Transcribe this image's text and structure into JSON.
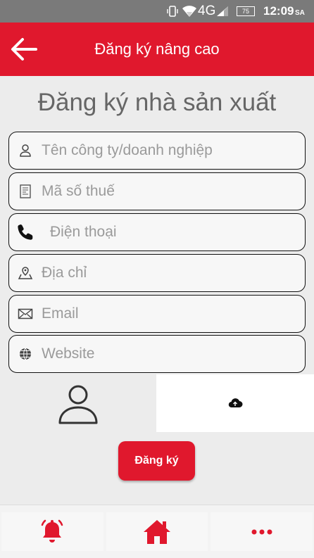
{
  "status_bar": {
    "network": "4G",
    "battery": "75",
    "time": "12:09",
    "ampm": "SA",
    "icons": [
      "vibrate-icon",
      "wifi-icon",
      "signal-icon",
      "battery-icon"
    ]
  },
  "app_bar": {
    "title": "Đăng ký nâng cao",
    "back_icon": "arrow-left-icon"
  },
  "page": {
    "title": "Đăng ký nhà sản xuất"
  },
  "form": {
    "company_placeholder": "Tên công ty/doanh nghiệp",
    "tax_placeholder": "Mã số thuế",
    "phone_placeholder": "Điện thoại",
    "address_placeholder": "Địa chỉ",
    "email_placeholder": "Email",
    "website_placeholder": "Website"
  },
  "actions": {
    "submit_label": "Đăng ký"
  },
  "bottom_nav": {
    "items": [
      "bell-icon",
      "home-icon",
      "more-icon"
    ]
  },
  "colors": {
    "primary": "#e0182d",
    "status_bar": "#7a7a7a",
    "background": "#ececec"
  }
}
